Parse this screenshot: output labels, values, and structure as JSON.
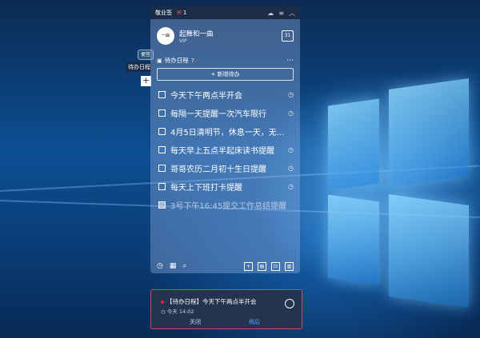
{
  "app": {
    "title": "敬业签",
    "badge": "1"
  },
  "user": {
    "name": "起舞和一曲",
    "level": "VIP",
    "avatar_text": "一曲"
  },
  "section": {
    "title": "待办日程",
    "count": "7",
    "new_button": "+ 新增待办"
  },
  "tasks": [
    {
      "text": "今天下午两点半开会",
      "done": false
    },
    {
      "text": "每隔一天提醒一次汽车限行",
      "done": false
    },
    {
      "text": "4月5日清明节，休息一天，无...",
      "done": false
    },
    {
      "text": "每天早上五点半起床读书提醒",
      "done": false
    },
    {
      "text": "哥哥农历二月初十生日提醒",
      "done": false
    },
    {
      "text": "每天上下班打卡提醒",
      "done": false
    },
    {
      "text": "3号下午16:45提交工作总结提醒",
      "done": true
    }
  ],
  "ghost": {
    "pill": "便签",
    "label": "待办日程",
    "plus": "+"
  },
  "notification": {
    "title": "【待办日程】今天下午两点半开会",
    "time": "今天  14:02",
    "close": "关闭",
    "snooze": "稍后"
  },
  "colors": {
    "accent": "#4aa3ff",
    "notify_border": "#d04a56",
    "badge": "#e23"
  }
}
